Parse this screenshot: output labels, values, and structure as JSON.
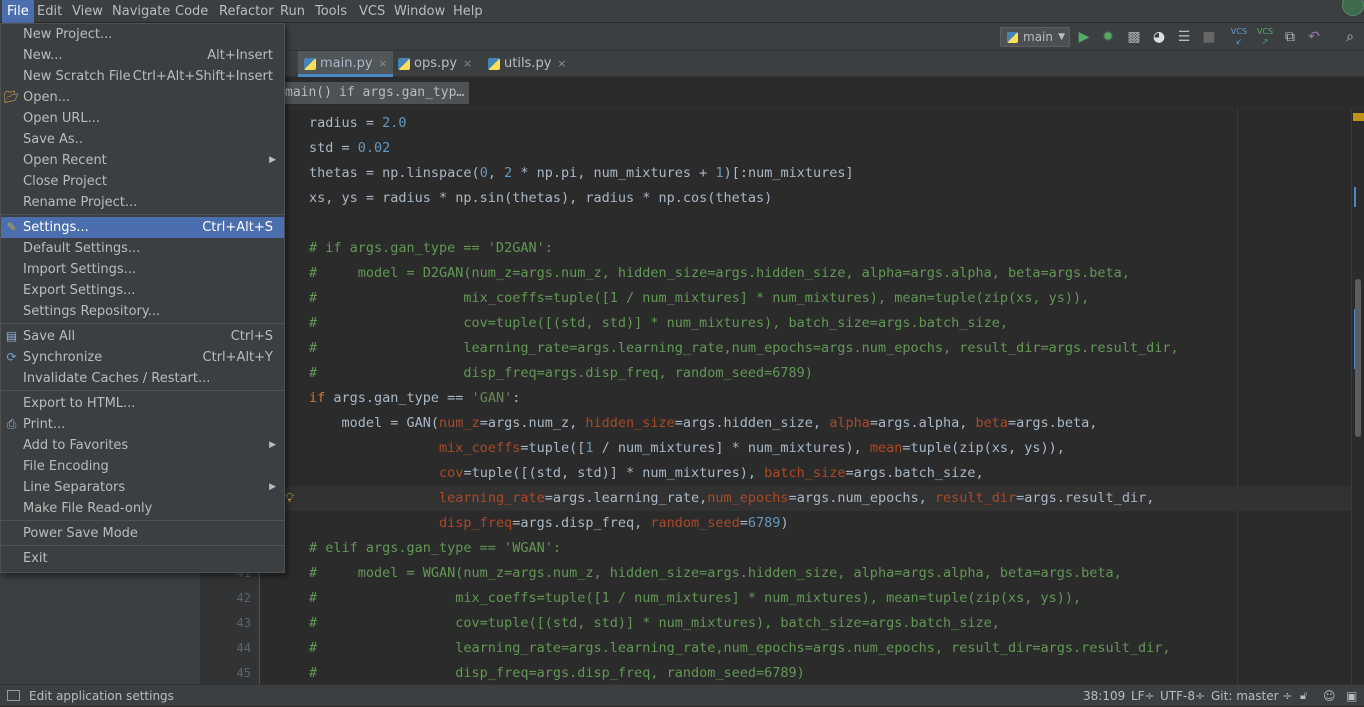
{
  "menubar": {
    "items": [
      "File",
      "Edit",
      "View",
      "Navigate",
      "Code",
      "Refactor",
      "Run",
      "Tools",
      "VCS",
      "Window",
      "Help"
    ],
    "active": "File"
  },
  "toolbar": {
    "run_config": "main",
    "icons": [
      "run-icon",
      "debug-icon",
      "coverage-icon",
      "profile-icon",
      "concurrency-icon",
      "stop-icon",
      "vcs-update-icon",
      "vcs-commit-icon",
      "history-icon",
      "revert-icon",
      "search-icon"
    ],
    "vcs_label": "VCS"
  },
  "tabs": [
    {
      "label": "main.py",
      "active": true,
      "close": "×"
    },
    {
      "label": "ops.py",
      "active": false,
      "close": "×"
    },
    {
      "label": "utils.py",
      "active": false,
      "close": "×"
    }
  ],
  "breadcrumbs": [
    "main()",
    "if args.gan_typ…"
  ],
  "file_menu": {
    "items": [
      {
        "label": "New Project...",
        "shortcut": ""
      },
      {
        "label": "New...",
        "shortcut": "Alt+Insert"
      },
      {
        "label": "New Scratch File",
        "shortcut": "Ctrl+Alt+Shift+Insert"
      },
      {
        "label": "Open...",
        "shortcut": "",
        "icon": "folder-icon"
      },
      {
        "label": "Open URL...",
        "shortcut": ""
      },
      {
        "label": "Save As..",
        "shortcut": ""
      },
      {
        "label": "Open Recent",
        "shortcut": "",
        "submenu": true
      },
      {
        "label": "Close Project",
        "shortcut": ""
      },
      {
        "label": "Rename Project...",
        "shortcut": ""
      },
      {
        "label": "Settings...",
        "shortcut": "Ctrl+Alt+S",
        "selected": true,
        "icon": "wrench-icon"
      },
      {
        "label": "Default Settings...",
        "shortcut": ""
      },
      {
        "label": "Import Settings...",
        "shortcut": ""
      },
      {
        "label": "Export Settings...",
        "shortcut": ""
      },
      {
        "label": "Settings Repository...",
        "shortcut": ""
      },
      {
        "label": "Save All",
        "shortcut": "Ctrl+S",
        "icon": "save-icon"
      },
      {
        "label": "Synchronize",
        "shortcut": "Ctrl+Alt+Y",
        "icon": "sync-icon"
      },
      {
        "label": "Invalidate Caches / Restart...",
        "shortcut": ""
      },
      {
        "label": "Export to HTML...",
        "shortcut": ""
      },
      {
        "label": "Print...",
        "shortcut": "",
        "icon": "print-icon"
      },
      {
        "label": "Add to Favorites",
        "shortcut": "",
        "submenu": true
      },
      {
        "label": "File Encoding",
        "shortcut": ""
      },
      {
        "label": "Line Separators",
        "shortcut": "",
        "submenu": true
      },
      {
        "label": "Make File Read-only",
        "shortcut": ""
      },
      {
        "label": "Power Save Mode",
        "shortcut": ""
      },
      {
        "label": "Exit",
        "shortcut": ""
      }
    ],
    "submenu_arrow": "▶"
  },
  "gutter": {
    "line_numbers": [
      "41",
      "42",
      "43",
      "44",
      "45"
    ]
  },
  "code": [
    {
      "tokens": [
        [
          "radius = ",
          ""
        ],
        [
          "2.0",
          "n"
        ]
      ]
    },
    {
      "tokens": [
        [
          "std = ",
          ""
        ],
        [
          "0.02",
          "n"
        ]
      ]
    },
    {
      "tokens": [
        [
          "thetas = np.linspace(",
          ""
        ],
        [
          "0",
          "n"
        ],
        [
          ", ",
          ""
        ],
        [
          "2",
          "n"
        ],
        [
          " * np.pi, num_mixtures + ",
          ""
        ],
        [
          "1",
          "n"
        ],
        [
          ")[:num_mixtures]",
          ""
        ]
      ]
    },
    {
      "tokens": [
        [
          "xs, ys = radius * np.sin(thetas), radius * np.cos(thetas)",
          ""
        ]
      ]
    },
    {
      "tokens": [
        [
          "",
          ""
        ]
      ]
    },
    {
      "tokens": [
        [
          "# if args.gan_type == 'D2GAN':",
          "c"
        ]
      ]
    },
    {
      "tokens": [
        [
          "#     model = D2GAN(num_z=args.num_z, hidden_size=args.hidden_size, alpha=args.alpha, beta=args.beta,",
          "c"
        ]
      ]
    },
    {
      "tokens": [
        [
          "#                  mix_coeffs=tuple([1 / num_mixtures] * num_mixtures), mean=tuple(zip(xs, ys)),",
          "c"
        ]
      ]
    },
    {
      "tokens": [
        [
          "#                  cov=tuple([(std, std)] * num_mixtures), batch_size=args.batch_size,",
          "c"
        ]
      ]
    },
    {
      "tokens": [
        [
          "#                  learning_rate=args.learning_rate,num_epochs=args.num_epochs, result_dir=args.result_dir,",
          "c"
        ]
      ]
    },
    {
      "tokens": [
        [
          "#                  disp_freq=args.disp_freq, random_seed=6789)",
          "c"
        ]
      ]
    },
    {
      "tokens": [
        [
          "if",
          "k"
        ],
        [
          " args.gan_type == ",
          ""
        ],
        [
          "'GAN'",
          "s"
        ],
        [
          ":",
          ""
        ]
      ]
    },
    {
      "tokens": [
        [
          "    model = GAN(",
          ""
        ],
        [
          "num_z",
          "p"
        ],
        [
          "=args.num_z, ",
          ""
        ],
        [
          "hidden_size",
          "p"
        ],
        [
          "=args.hidden_size, ",
          ""
        ],
        [
          "alpha",
          "p"
        ],
        [
          "=args.alpha, ",
          ""
        ],
        [
          "beta",
          "p"
        ],
        [
          "=args.beta,",
          ""
        ]
      ]
    },
    {
      "tokens": [
        [
          "                ",
          ""
        ],
        [
          "mix_coeffs",
          "p"
        ],
        [
          "=tuple([",
          ""
        ],
        [
          "1",
          "n"
        ],
        [
          " / num_mixtures] * num_mixtures), ",
          ""
        ],
        [
          "mean",
          "p"
        ],
        [
          "=tuple(zip(xs, ys)),",
          ""
        ]
      ]
    },
    {
      "tokens": [
        [
          "                ",
          ""
        ],
        [
          "cov",
          "p"
        ],
        [
          "=tuple([(std, std)] * num_mixtures), ",
          ""
        ],
        [
          "batch_size",
          "p"
        ],
        [
          "=args.batch_size,",
          ""
        ]
      ]
    },
    {
      "tokens": [
        [
          "                ",
          ""
        ],
        [
          "learning_rate",
          "p"
        ],
        [
          "=args.learning_rate,",
          ""
        ],
        [
          "num_epochs",
          "p"
        ],
        [
          "=args.num_epochs, ",
          ""
        ],
        [
          "result_dir",
          "p"
        ],
        [
          "=args.result_dir,",
          ""
        ]
      ],
      "current": true
    },
    {
      "tokens": [
        [
          "                ",
          ""
        ],
        [
          "disp_freq",
          "p"
        ],
        [
          "=args.disp_freq, ",
          ""
        ],
        [
          "random_seed",
          "p"
        ],
        [
          "=",
          ""
        ],
        [
          "6789",
          "n"
        ],
        [
          ")",
          ""
        ]
      ]
    },
    {
      "tokens": [
        [
          "# elif args.gan_type == 'WGAN':",
          "c"
        ]
      ]
    },
    {
      "tokens": [
        [
          "#     model = WGAN(num_z=args.num_z, hidden_size=args.hidden_size, alpha=args.alpha, beta=args.beta,",
          "c"
        ]
      ]
    },
    {
      "tokens": [
        [
          "#                 mix_coeffs=tuple([1 / num_mixtures] * num_mixtures), mean=tuple(zip(xs, ys)),",
          "c"
        ]
      ]
    },
    {
      "tokens": [
        [
          "#                 cov=tuple([(std, std)] * num_mixtures), batch_size=args.batch_size,",
          "c"
        ]
      ]
    },
    {
      "tokens": [
        [
          "#                 learning_rate=args.learning_rate,num_epochs=args.num_epochs, result_dir=args.result_dir,",
          "c"
        ]
      ]
    },
    {
      "tokens": [
        [
          "#                 disp_freq=args.disp_freq, random_seed=6789)",
          "c"
        ]
      ]
    }
  ],
  "statusbar": {
    "message": "Edit application settings",
    "position": "38:109",
    "line_sep": "LF÷",
    "encoding": "UTF-8÷",
    "git": "Git: master ÷"
  }
}
